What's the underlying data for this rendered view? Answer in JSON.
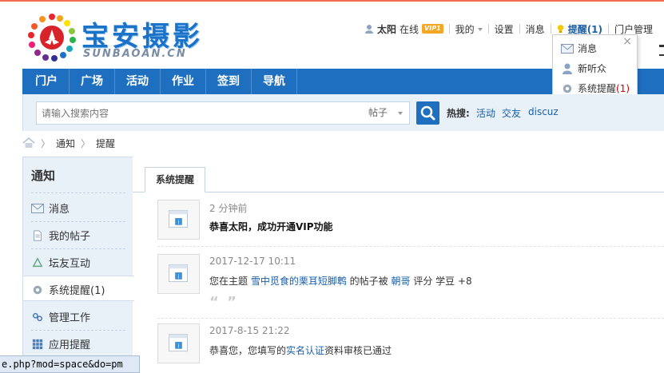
{
  "logo": {
    "title": "宝安摄影",
    "subtitle": "SUNBAOAN.CN"
  },
  "userbar": {
    "username": "太阳",
    "online": "在线",
    "vip": "VIP1",
    "mine": "我的",
    "settings": "设置",
    "messages": "消息",
    "remind": "提醒(1)",
    "portal_manage": "门户管理"
  },
  "dropdown": {
    "items": [
      {
        "label": "消息",
        "icon": "envelope-icon"
      },
      {
        "label": "新听众",
        "icon": "user-icon"
      },
      {
        "label": "系统提醒",
        "count": "(1)",
        "icon": "gear-icon"
      }
    ],
    "close": "×"
  },
  "nav": {
    "items": [
      "门户",
      "广场",
      "活动",
      "作业",
      "签到",
      "导航"
    ]
  },
  "search": {
    "placeholder": "请输入搜索内容",
    "scope": "帖子",
    "hot_label": "热搜:",
    "hot_tags": [
      "活动",
      "交友",
      "discuz"
    ]
  },
  "breadcrumb": {
    "items": [
      "通知",
      "提醒"
    ]
  },
  "sidebar": {
    "title": "通知",
    "items": [
      {
        "label": "消息",
        "icon": "envelope-icon"
      },
      {
        "label": "我的帖子",
        "icon": "document-icon"
      },
      {
        "label": "坛友互动",
        "icon": "recycle-icon"
      },
      {
        "label": "系统提醒(1)",
        "icon": "gear-icon"
      },
      {
        "label": "管理工作",
        "icon": "link-icon"
      },
      {
        "label": "应用提醒",
        "icon": "grid-icon"
      }
    ]
  },
  "main": {
    "tab": "系统提醒",
    "notices": [
      {
        "time": "2 分钟前",
        "text": "恭喜太阳，成功开通VIP功能"
      },
      {
        "time": "2017-12-17 10:11",
        "prefix": "您在主题 ",
        "link": "雪中觅食的栗耳短脚鹎",
        "middle": " 的帖子被 ",
        "user": "朝哥",
        "suffix": " 评分 学豆 +8",
        "quote": "“ ”"
      },
      {
        "time": "2017-8-15 21:22",
        "prefix": "恭喜您，您填写的",
        "link": "实名认证",
        "suffix": "资料审核已通过"
      }
    ]
  },
  "statusbar": {
    "url": "e.php?mod=space&do=pm"
  },
  "colors": {
    "nav": "#1e6fbf",
    "link": "#1a5fa8",
    "accent_line": "#f26c4f"
  }
}
